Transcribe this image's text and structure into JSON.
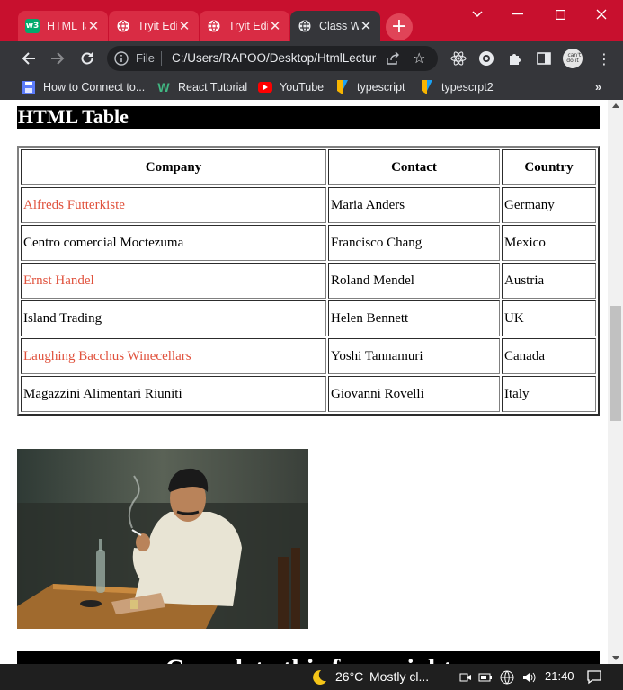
{
  "browser": {
    "tabs": [
      {
        "title": "HTML Tables",
        "icon": "w3schools-icon",
        "active": false
      },
      {
        "title": "Tryit Editor",
        "icon": "globe-icon",
        "active": false
      },
      {
        "title": "Tryit Editor",
        "icon": "globe-icon",
        "active": false
      },
      {
        "title": "Class Work",
        "icon": "globe-icon",
        "active": true
      }
    ],
    "address": {
      "scheme_label": "File",
      "url": "C:/Users/RAPOO/Desktop/HtmlLecture/classwork.html"
    },
    "bookmarks": [
      {
        "label": "How to Connect to...",
        "icon": "floppy-icon"
      },
      {
        "label": "React Tutorial",
        "icon": "w-logo-icon"
      },
      {
        "label": "YouTube",
        "icon": "youtube-icon"
      },
      {
        "label": "typescript",
        "icon": "bookmark-flag-icon"
      },
      {
        "label": "typescrpt2",
        "icon": "bookmark-flag-icon"
      }
    ],
    "profile_text": "I can't do it",
    "colors": {
      "tabstrip": "#c8102e",
      "toolbar": "#35363a",
      "link_red": "#e0523d"
    }
  },
  "page": {
    "heading": "HTML Table",
    "table": {
      "headers": [
        "Company",
        "Contact",
        "Country"
      ],
      "rows": [
        {
          "company": "Alfreds Futterkiste",
          "contact": "Maria Anders",
          "country": "Germany",
          "highlight": true
        },
        {
          "company": "Centro comercial Moctezuma",
          "contact": "Francisco Chang",
          "country": "Mexico",
          "highlight": false
        },
        {
          "company": "Ernst Handel",
          "contact": "Roland Mendel",
          "country": "Austria",
          "highlight": true
        },
        {
          "company": "Island Trading",
          "contact": "Helen Bennett",
          "country": "UK",
          "highlight": false
        },
        {
          "company": "Laughing Bacchus Winecellars",
          "contact": "Yoshi Tannamuri",
          "country": "Canada",
          "highlight": true
        },
        {
          "company": "Magazzini Alimentari Riuniti",
          "contact": "Giovanni Rovelli",
          "country": "Italy",
          "highlight": false
        }
      ]
    },
    "bottom_heading": "Complete this form right"
  },
  "taskbar": {
    "temperature": "26°C",
    "condition": "Mostly cl...",
    "time": "21:40"
  }
}
